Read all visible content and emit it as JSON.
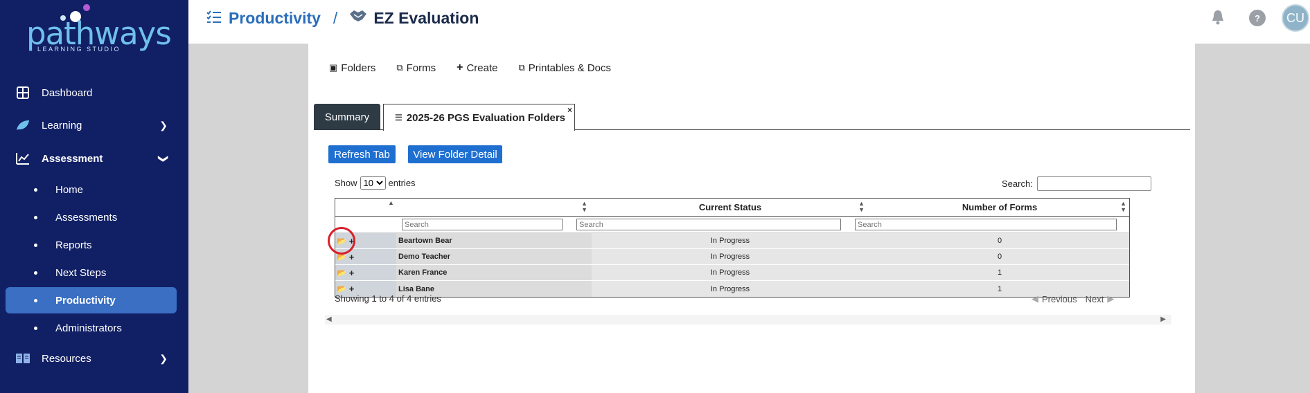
{
  "sidebar": {
    "logo_text": "pathways",
    "logo_sub": "LEARNING STUDIO",
    "items": [
      {
        "label": "Dashboard",
        "icon": "dashboard-icon"
      },
      {
        "label": "Learning",
        "icon": "leaf-icon"
      },
      {
        "label": "Assessment",
        "icon": "chart-icon"
      },
      {
        "label": "Resources",
        "icon": "book-icon"
      }
    ],
    "sub_items": [
      {
        "label": "Home"
      },
      {
        "label": "Assessments"
      },
      {
        "label": "Reports"
      },
      {
        "label": "Next Steps"
      },
      {
        "label": "Productivity",
        "active": true
      },
      {
        "label": "Administrators"
      }
    ]
  },
  "header": {
    "crumb1": "Productivity",
    "crumb_sep": "/",
    "crumb2": "EZ Evaluation",
    "help": "?",
    "avatar": "CU"
  },
  "toolbar": {
    "folders": "Folders",
    "forms": "Forms",
    "create": "Create",
    "printables": "Printables & Docs"
  },
  "tabs": {
    "summary": "Summary",
    "active": "2025-26 PGS Evaluation Folders",
    "close": "×"
  },
  "buttons": {
    "refresh": "Refresh Tab",
    "view_folder": "View Folder Detail"
  },
  "table": {
    "show_label": "Show",
    "show_value": "10",
    "entries_label": "entries",
    "search_label": "Search:",
    "columns": [
      "",
      "",
      "Current Status",
      "Number of Forms"
    ],
    "filter_placeholder": "Search",
    "rows": [
      {
        "name": "Beartown Bear",
        "status": "In Progress",
        "forms": "0"
      },
      {
        "name": "Demo Teacher",
        "status": "In Progress",
        "forms": "0"
      },
      {
        "name": "Karen France",
        "status": "In Progress",
        "forms": "1"
      },
      {
        "name": "Lisa Bane",
        "status": "In Progress",
        "forms": "1"
      }
    ],
    "info": "Showing 1 to 4 of 4 entries",
    "previous": "Previous",
    "next": "Next"
  },
  "colors": {
    "sidebar_bg": "#112065",
    "active_item": "#3a6fc4",
    "button": "#1f6fd1",
    "annotation": "#d8202a"
  }
}
